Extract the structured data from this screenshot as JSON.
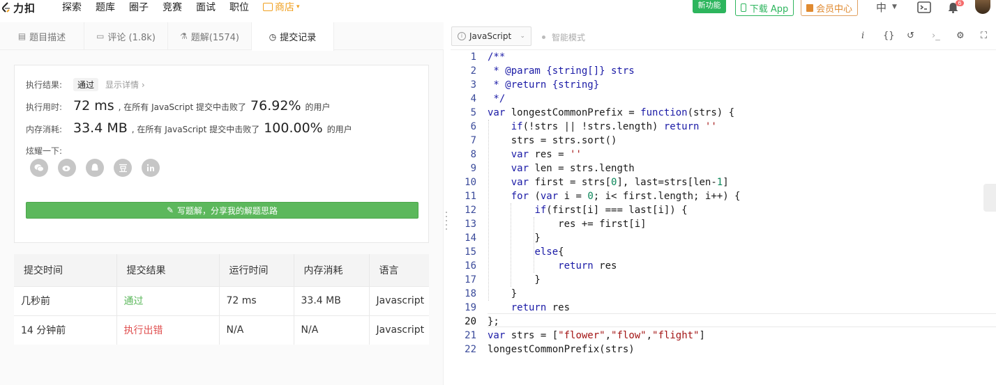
{
  "nav": {
    "logo_text": "力扣",
    "items": [
      "探索",
      "题库",
      "圈子",
      "竞赛",
      "面试",
      "职位"
    ],
    "store_label": "商店",
    "new_feature_badge": "新功能",
    "download_app_label": "下载 App",
    "vip_label": "会员中心",
    "lang_label": "中",
    "notification_count": "6"
  },
  "tabs": [
    {
      "label": "题目描述",
      "icon": "description-icon"
    },
    {
      "label": "评论 (1.8k)",
      "icon": "comment-icon"
    },
    {
      "label": "题解(1574)",
      "icon": "flask-icon"
    },
    {
      "label": "提交记录",
      "icon": "clock-icon",
      "active": true
    }
  ],
  "result": {
    "status_label": "执行结果:",
    "status_value": "通过",
    "show_detail": "显示详情 ›",
    "time_label": "执行用时:",
    "time_value": "72 ms",
    "time_text": ", 在所有 JavaScript 提交中击败了",
    "time_percent": "76.92%",
    "users_text": "的用户",
    "memory_label": "内存消耗:",
    "memory_value": "33.4 MB",
    "memory_text": ", 在所有 JavaScript 提交中击败了",
    "memory_percent": "100.00%",
    "share_label": "炫耀一下:",
    "share_icons": [
      "wechat-icon",
      "weibo-icon",
      "qq-icon",
      "douban-icon",
      "linkedin-icon"
    ],
    "write_solution_label": "写题解，分享我的解题思路"
  },
  "submissions": {
    "headers": [
      "提交时间",
      "提交结果",
      "运行时间",
      "内存消耗",
      "语言"
    ],
    "rows": [
      {
        "time": "几秒前",
        "result": "通过",
        "result_color": "#5cb85c",
        "runtime": "72 ms",
        "memory": "33.4 MB",
        "lang": "Javascript"
      },
      {
        "time": "14 分钟前",
        "result": "执行出错",
        "result_color": "#e05252",
        "runtime": "N/A",
        "memory": "N/A",
        "lang": "Javascript"
      }
    ]
  },
  "editor": {
    "language": "JavaScript",
    "smart_mode_label": "智能模式",
    "toolbar_icons": [
      "info-icon",
      "braces-icon",
      "undo-icon",
      "terminal-icon",
      "settings-icon",
      "fullscreen-icon"
    ],
    "current_line": 20,
    "lines": [
      "/**",
      " * @param {string[]} strs",
      " * @return {string}",
      " */",
      "var longestCommonPrefix = function(strs) {",
      "    if(!strs || !strs.length) return ''",
      "    strs = strs.sort()",
      "    var res = ''",
      "    var len = strs.length",
      "    var first = strs[0], last=strs[len-1]",
      "    for (var i = 0; i< first.length; i++) {",
      "        if(first[i] === last[i]) {",
      "            res += first[i]",
      "        }",
      "        else{",
      "            return res",
      "        }",
      "    }",
      "    return res",
      "};",
      "var strs = [\"flower\",\"flow\",\"flight\"]",
      "longestCommonPrefix(strs)"
    ]
  }
}
